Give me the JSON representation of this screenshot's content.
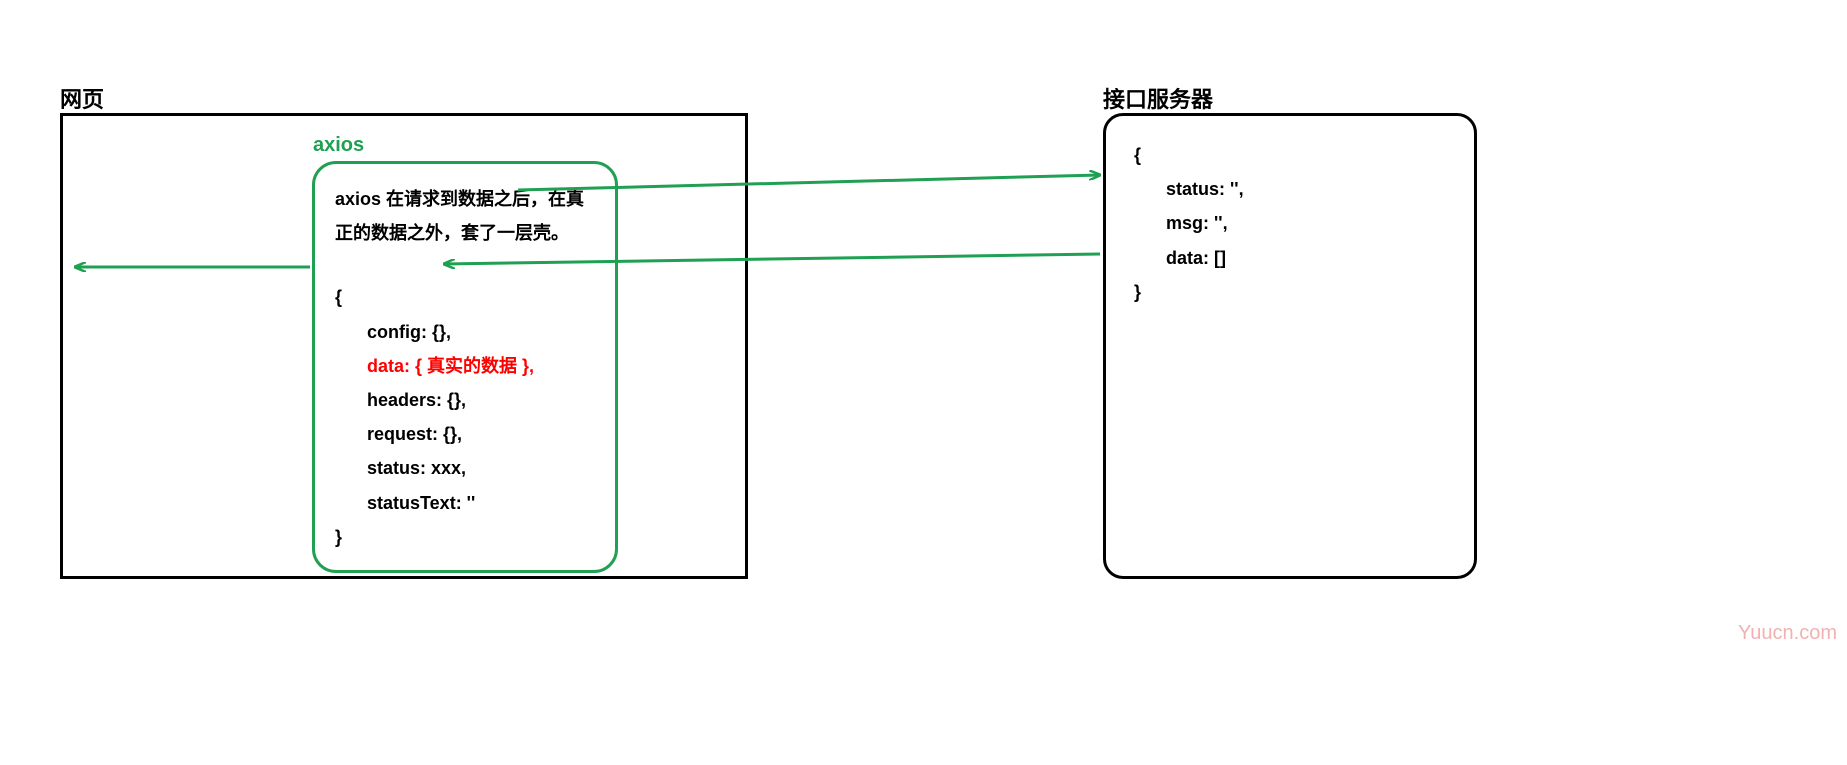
{
  "webpage": {
    "title": "网页"
  },
  "axios": {
    "label": "axios",
    "description": "axios 在请求到数据之后，在真正的数据之外，套了一层壳。",
    "response": {
      "open": "{",
      "config": "config: {},",
      "data": "data: { 真实的数据 },",
      "headers": "headers: {},",
      "request": "request: {},",
      "status": "status: xxx,",
      "statusText": "statusText: ''",
      "close": "}"
    }
  },
  "server": {
    "title": "接口服务器",
    "response": {
      "open": "{",
      "status": "status: '',",
      "msg": "msg: '',",
      "data": "data: []",
      "close": "}"
    }
  },
  "watermark": "Yuucn.com",
  "arrows": {
    "color": "#1fa052"
  }
}
